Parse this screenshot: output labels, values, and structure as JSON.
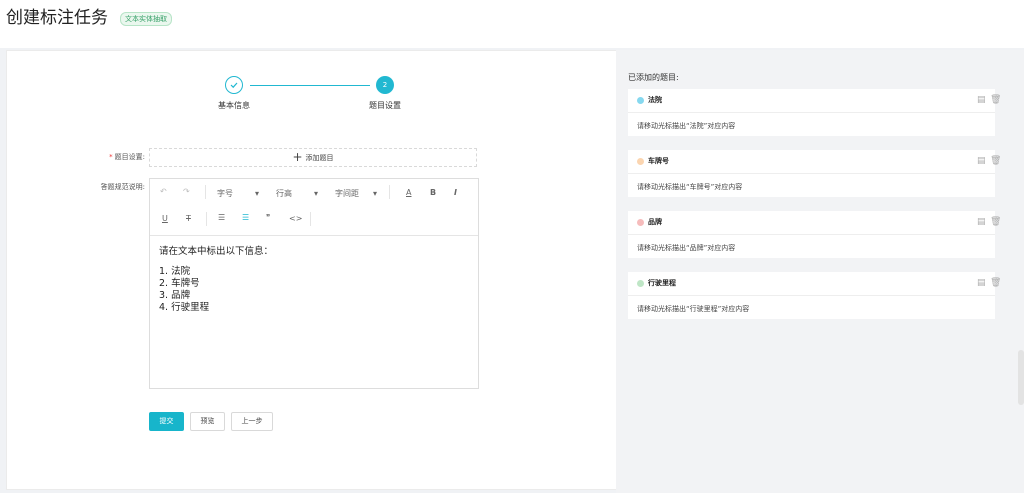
{
  "header": {
    "title": "创建标注任务",
    "tag": "文本实体抽取"
  },
  "steps": [
    {
      "label": "基本信息",
      "icon": "check-icon"
    },
    {
      "label": "题目设置",
      "number": "2"
    }
  ],
  "form": {
    "question_label": "题目设置:",
    "add_button": "添加题目",
    "guide_label": "答题规范说明:"
  },
  "toolbar": {
    "font_size": "字号",
    "line_height": "行高",
    "letter_spacing": "字间距",
    "font_color": "A",
    "bold": "B",
    "italic": "I",
    "underline": "U",
    "strikethrough": "T",
    "quote": "❞",
    "code": "<>"
  },
  "editor": {
    "intro": "请在文本中标出以下信息：",
    "items": [
      "1.  法院",
      "2.  车牌号",
      "3.  品牌",
      "4.  行驶里程"
    ]
  },
  "buttons": {
    "submit": "提交",
    "preview": "预览",
    "prev": "上一步"
  },
  "added": {
    "title": "已添加的题目:",
    "questions": [
      {
        "name": "法院",
        "desc": "请移动光标描出“法院”对应内容",
        "color": "#86d8ef"
      },
      {
        "name": "车牌号",
        "desc": "请移动光标描出“车牌号”对应内容",
        "color": "#fbd5b0"
      },
      {
        "name": "品牌",
        "desc": "请移动光标描出“品牌”对应内容",
        "color": "#f6bcbc"
      },
      {
        "name": "行驶里程",
        "desc": "请移动光标描出“行驶里程”对应内容",
        "color": "#bfe6c6"
      }
    ]
  },
  "colors": {
    "accent": "#21b8d1",
    "submit": "#17b5cb"
  }
}
